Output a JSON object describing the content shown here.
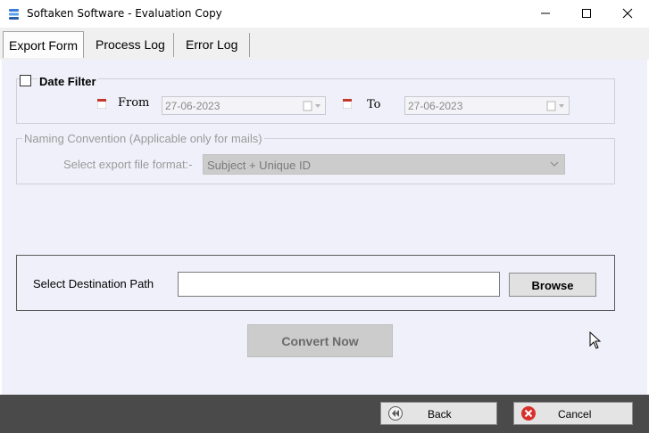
{
  "window": {
    "title": "Softaken Software - Evaluation Copy",
    "icons": {
      "app": "app-logo-icon",
      "minimize": "minimize-icon",
      "maximize": "maximize-icon",
      "close": "close-icon"
    }
  },
  "tabs": [
    {
      "label": "Export Form",
      "active": true
    },
    {
      "label": "Process Log",
      "active": false
    },
    {
      "label": "Error Log",
      "active": false
    }
  ],
  "date_filter": {
    "label": "Date Filter",
    "checked": false,
    "from_label": "From",
    "from_value": "27-06-2023",
    "to_label": "To",
    "to_value": "27-06-2023"
  },
  "naming": {
    "group_label": "Naming Convention (Applicable only for mails)",
    "field_label": "Select export file format:-",
    "selected_value": "Subject + Unique ID"
  },
  "destination": {
    "label": "Select Destination Path",
    "value": "",
    "browse_label": "Browse"
  },
  "convert_label": "Convert Now",
  "footer": {
    "back_label": "Back",
    "cancel_label": "Cancel"
  },
  "colors": {
    "content_bg": "#f0f0fa",
    "footer_bg": "#4a4a4a",
    "cancel_icon": "#d9302a",
    "calendar_icon": "#c0392b"
  }
}
